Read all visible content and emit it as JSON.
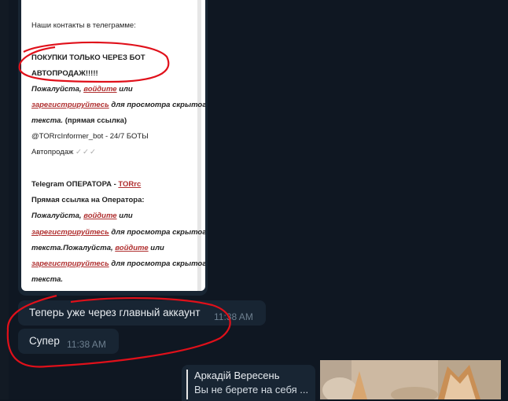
{
  "shot": {
    "line_contacts": "Наши контакты в телеграмме:",
    "line_buy1": "ПОКУПКИ ТОЛЬКО ЧЕРЕЗ БОТ",
    "line_buy2": "АВТОПРОДАЖ!!!!!",
    "please": "Пожалуйста, ",
    "login": "войдите",
    "or": " или",
    "register": "зарегистрируйтесь",
    "for_hidden": " для просмотра скрытого",
    "text_direct": "текста.",
    "direct_link": " (прямая ссылка)",
    "bot_line": "@TORrcInformer_bot - 24/7 БОТЫ",
    "autosales": "Автопродаж ",
    "checks": "✓✓✓",
    "operator_label": "Telegram ОПЕРАТОРА - ",
    "operator_link": "TORrc",
    "direct_operator": "Прямая ссылка на Оператора:",
    "please2": "Пожалуйста, ",
    "login2": "войдите",
    "or2": " или",
    "register2": "зарегистрируйтесь",
    "for_hidden2": " для просмотра скрытого",
    "text_please": "текста.Пожалуйста, ",
    "login3": "войдите",
    "or3": " или",
    "register3": "зарегистрируйтесь",
    "for_hidden3": " для просмотра скрытого",
    "text_end": "текста."
  },
  "messages": [
    {
      "text": "Теперь  уже через  главный аккаунт",
      "time": "11:38 AM"
    },
    {
      "text": "Супер",
      "time": "11:38 AM"
    }
  ],
  "reply": {
    "name": "Аркадій Вересень",
    "preview": "Вы не берете на себя ..."
  },
  "colors": {
    "background": "#0e1621",
    "bubble": "#182533",
    "annotation": "#e0101a",
    "link": "#b03030"
  }
}
